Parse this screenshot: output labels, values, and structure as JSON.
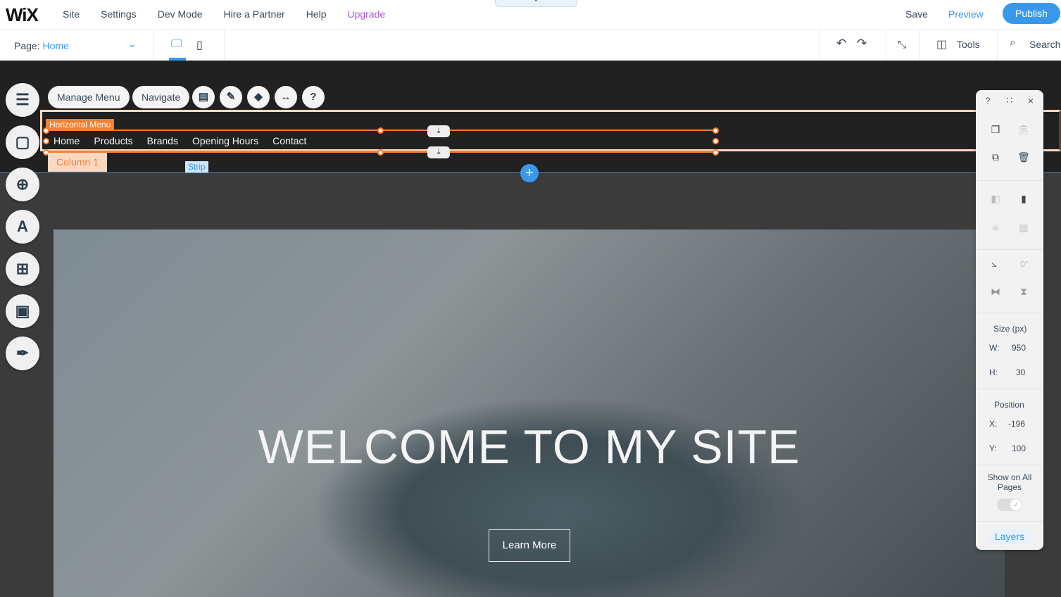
{
  "topbar": {
    "logo": "WiX",
    "menu": [
      "Site",
      "Settings",
      "Dev Mode",
      "Hire a Partner",
      "Help",
      "Upgrade"
    ],
    "save": "Save",
    "preview": "Preview",
    "publish": "Publish",
    "upgrade_color": "#a95ad8",
    "accent": "#3899ec"
  },
  "toolbar": {
    "page_label": "Page:",
    "page_value": "Home",
    "tools": "Tools",
    "search": "Search",
    "active_device": "desktop"
  },
  "menu_toolbar": {
    "manage_menu": "Manage Menu",
    "navigate": "Navigate"
  },
  "selection": {
    "label": "Horizontal Menu",
    "color": "#f7802f",
    "items": [
      "Home",
      "Products",
      "Brands",
      "Opening Hours",
      "Contact"
    ],
    "column": "Column 1",
    "strip": "Strip"
  },
  "hero": {
    "title": "WELCOME TO MY SITE",
    "button": "Learn More"
  },
  "panel": {
    "help": "?",
    "rotation": "0°",
    "size_title": "Size (px)",
    "w_label": "W:",
    "w_value": "950",
    "h_label": "H:",
    "h_value": "30",
    "position_title": "Position",
    "x_label": "X:",
    "x_value": "-196",
    "y_label": "Y:",
    "y_value": "100",
    "show_all": "Show on All Pages",
    "show_all_on": true,
    "layers": "Layers"
  }
}
